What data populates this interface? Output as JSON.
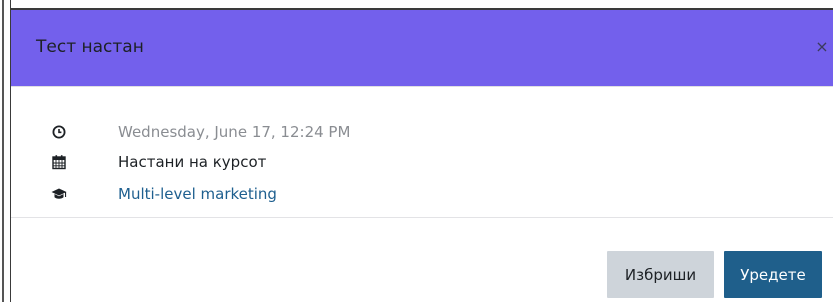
{
  "modal": {
    "title": "Тест настан",
    "close_symbol": "×"
  },
  "event": {
    "date": "Wednesday, June 17, 12:24 PM",
    "event_type": "Настани на курсот",
    "course": "Multi-level marketing"
  },
  "icons": {
    "date": "clock-icon",
    "event_type": "calendar-icon",
    "course": "graduation-cap-icon"
  },
  "footer": {
    "delete_label": "Избриши",
    "edit_label": "Уредете"
  },
  "colors": {
    "header_bg": "#7360ec",
    "primary_button": "#1f5f8b",
    "secondary_button": "#ced4da",
    "link": "#1e5f8f"
  }
}
